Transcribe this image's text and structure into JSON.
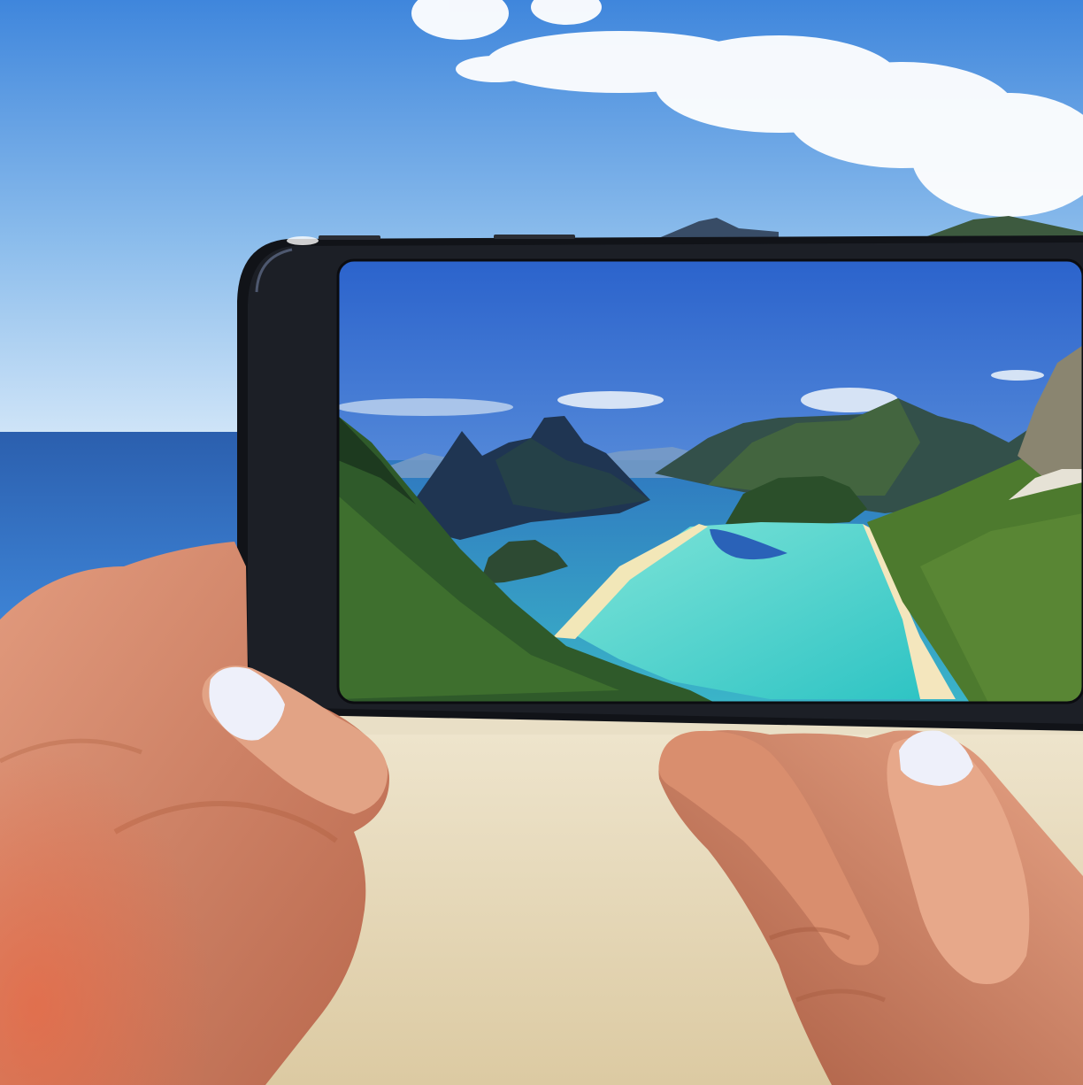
{
  "scene": {
    "description_visible_text": "",
    "colors": {
      "sky_top": "#4a8ad8",
      "sky_bottom": "#cfe3f7",
      "sea": "#2e6fc0",
      "sand": "#e8dcc0",
      "phone_body": "#15171c",
      "phone_screen_sky": "#2e62c8",
      "screen_water": "#3ecfc8",
      "screen_grass": "#4f7a2e",
      "skin": "#d9876a",
      "nail": "#eef0fa"
    }
  }
}
